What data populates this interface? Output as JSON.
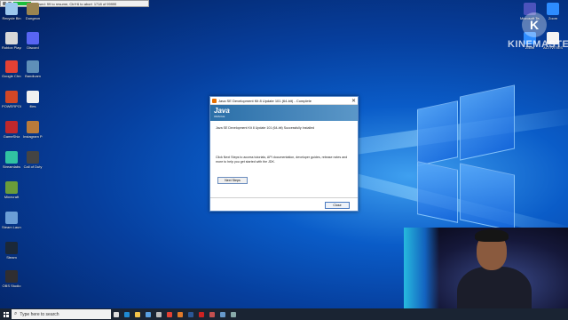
{
  "recorder": {
    "status": "Paused: 99 to resume, Ctrl+6 to abort",
    "frames": "1718 of 99999"
  },
  "desktop_icons": [
    {
      "label": "Recycle Bin",
      "color": "#9cc8ee"
    },
    {
      "label": "Dungeon",
      "color": "#9a8450"
    },
    {
      "label": "Roblox Player",
      "color": "#d8d8d8"
    },
    {
      "label": "Discord",
      "color": "#5865f2"
    },
    {
      "label": "Google Chrome",
      "color": "#e44134"
    },
    {
      "label": "Bandicam",
      "color": "#5f8fb8"
    },
    {
      "label": "POWERPOINT",
      "color": "#d24726"
    },
    {
      "label": "files",
      "color": "#f0f0f0"
    },
    {
      "label": "GameShiz",
      "color": "#c0282c"
    },
    {
      "label": "Instagram Post",
      "color": "#b97a3a"
    },
    {
      "label": "Streamlabs",
      "color": "#31c3a2"
    },
    {
      "label": "Call of Duty",
      "color": "#444444"
    },
    {
      "label": "Minecraft",
      "color": "#6a9c3a"
    },
    {
      "label": "Steam Launcher",
      "color": "#6b9ed6"
    },
    {
      "label": "Steam",
      "color": "#1b2838"
    },
    {
      "label": "OBS Studio",
      "color": "#302e31"
    }
  ],
  "top_right_icons": [
    {
      "label": "Microsoft Teams",
      "color": "#4b53bc"
    },
    {
      "label": "Zoom",
      "color": "#2d8cff"
    },
    {
      "label": "Zoom",
      "color": "#2d8cff"
    },
    {
      "label": "ACTIVITIES",
      "color": "#f4f4f4"
    }
  ],
  "watermark": {
    "text": "KINEMASTER",
    "letter": "K"
  },
  "dialog": {
    "title": "Java SE Development Kit 8 Update 101 (64-bit) - Complete",
    "logo": "Java",
    "logo_sub": "ORACLE",
    "success_msg": "Java SE Development Kit 8 Update 101 (64-bit) Successfully Installed",
    "info_msg": "Click Next Steps to access tutorials, API documentation, developer guides, release notes and more to help you get started with the JDK.",
    "next_label": "Next Steps",
    "close_label": "Close"
  },
  "taskbar": {
    "search_placeholder": "Type here to search",
    "apps": [
      {
        "name": "task-view-icon",
        "color": "#dddddd"
      },
      {
        "name": "edge-icon",
        "color": "#1f8ad2"
      },
      {
        "name": "file-explorer-icon",
        "color": "#f3c34a"
      },
      {
        "name": "store-icon",
        "color": "#5aa0e0"
      },
      {
        "name": "mail-icon",
        "color": "#bcbcbc"
      },
      {
        "name": "chrome-icon",
        "color": "#e44134"
      },
      {
        "name": "settings-icon",
        "color": "#e07a2a"
      },
      {
        "name": "word-icon",
        "color": "#2b5797"
      },
      {
        "name": "app-icon",
        "color": "#c22"
      },
      {
        "name": "java-icon",
        "color": "#c35050"
      },
      {
        "name": "bandicam-icon",
        "color": "#6699cc"
      },
      {
        "name": "installer-icon",
        "color": "#8aa"
      }
    ]
  }
}
